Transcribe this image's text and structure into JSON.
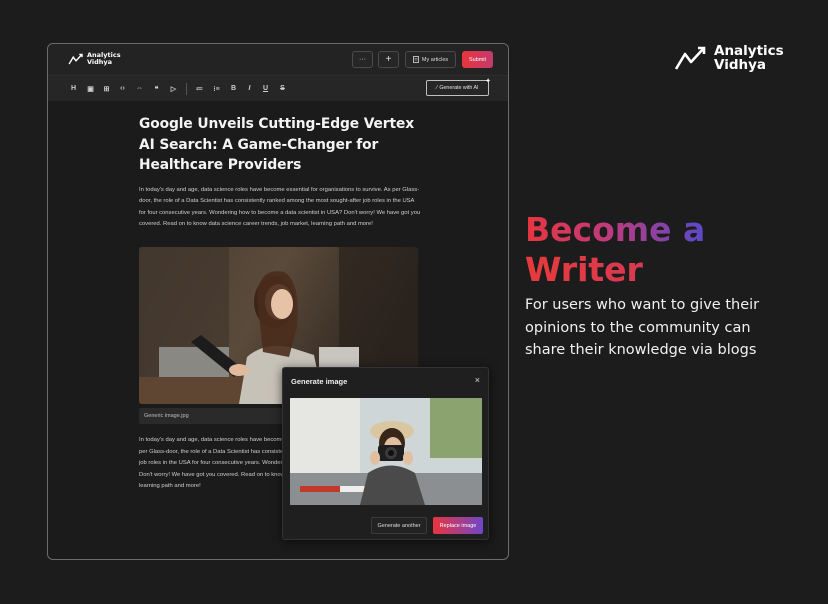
{
  "promo": {
    "brand_line1": "Analytics",
    "brand_line2": "Vidhya",
    "headline_line1": "Become a",
    "headline_line2": "Writer",
    "description": "For users who want to give their opinions to the community can share their knowledge via blogs"
  },
  "app": {
    "brand_line1": "Analytics",
    "brand_line2": "Vidhya",
    "topbar": {
      "more_label": "···",
      "add_label": "+",
      "my_articles_label": "My articles",
      "submit_label": "Submit"
    },
    "toolbar": {
      "tools": [
        "H",
        "▣",
        "⊞",
        "‹›",
        "⇔",
        "❝",
        "▷",
        "≔",
        "⁝≡",
        "B",
        "I",
        "U",
        "S"
      ],
      "generate_ai_label": "Generate with AI"
    },
    "article": {
      "title": "Google Unveils Cutting-Edge Vertex AI Search: A Game-Changer for Healthcare Providers",
      "paragraph": "In today's day and age, data science roles have become essential for organisations to survive. As per Glass-door, the role of a Data Scientist has consistently ranked among the most sought-after job roles in the USA for four consecutive years. Wondering how to become a data scientist in USA? Don't worry! We have got you covered. Read on to know data science career trends, job market, learning path and more!",
      "image_caption": "Generic image.jpg",
      "paragraph2_lines": [
        "In today's day and age, data science roles have become",
        "per Glass-door, the role of a Data Scientist has consistently",
        "job roles in the USA for four consecutive years. Wondering",
        "Don't worry! We have got you covered. Read on to know",
        "learning path and more!"
      ]
    },
    "modal": {
      "title": "Generate image",
      "close_label": "×",
      "generate_another_label": "Generate another",
      "replace_label": "Replace image"
    }
  }
}
